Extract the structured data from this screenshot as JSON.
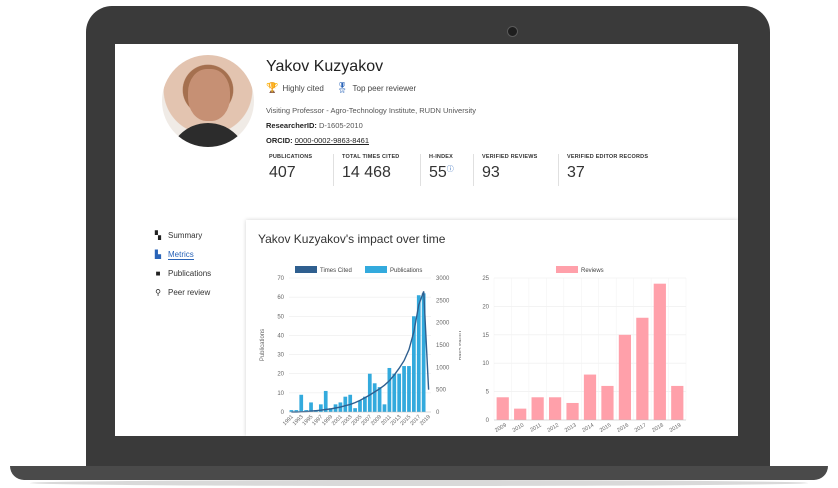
{
  "profile": {
    "name": "Yakov Kuzyakov",
    "badges": [
      {
        "label": "Highly cited",
        "icon": "trophy-icon"
      },
      {
        "label": "Top peer reviewer",
        "icon": "medal-icon"
      }
    ],
    "position": "Visiting Professor - Agro-Technology Institute, RUDN University",
    "researcher_id_label": "ResearcherID:",
    "researcher_id": "D-1605-2010",
    "orcid_label": "ORCID:",
    "orcid": "0000-0002-9863-8461"
  },
  "stats": [
    {
      "label": "PUBLICATIONS",
      "value": "407"
    },
    {
      "label": "TOTAL TIMES CITED",
      "value": "14 468"
    },
    {
      "label": "H-INDEX",
      "value": "55"
    },
    {
      "label": "VERIFIED REVIEWS",
      "value": "93"
    },
    {
      "label": "VERIFIED EDITOR RECORDS",
      "value": "37"
    }
  ],
  "nav": {
    "items": [
      {
        "label": "Summary",
        "icon": "summary-icon"
      },
      {
        "label": "Metrics",
        "icon": "metrics-icon"
      },
      {
        "label": "Publications",
        "icon": "publications-icon"
      },
      {
        "label": "Peer review",
        "icon": "search-icon"
      }
    ]
  },
  "panel": {
    "title": "Yakov Kuzyakov's impact over time"
  },
  "colors": {
    "times_cited": "#2f5f8f",
    "publications": "#33aadd",
    "reviews": "#ffa0aa"
  },
  "chart_data": [
    {
      "type": "bar",
      "legend": [
        "Times Cited",
        "Publications"
      ],
      "left_axis_label": "Publications",
      "right_axis_label": "Times cited",
      "left_ticks": [
        "0",
        "10",
        "20",
        "30",
        "40",
        "50",
        "60",
        "70"
      ],
      "right_ticks": [
        "0",
        "500",
        "1000",
        "1500",
        "2000",
        "2500",
        "3000"
      ],
      "x_tick_labels": [
        "1991",
        "1993",
        "1995",
        "1997",
        "1999",
        "2001",
        "2003",
        "2005",
        "2007",
        "2009",
        "2011",
        "2013",
        "2015",
        "2017",
        "2019"
      ],
      "x": [
        1991,
        1992,
        1993,
        1994,
        1995,
        1996,
        1997,
        1998,
        1999,
        2000,
        2001,
        2002,
        2003,
        2004,
        2005,
        2006,
        2007,
        2008,
        2009,
        2010,
        2011,
        2012,
        2013,
        2014,
        2015,
        2016,
        2017,
        2018,
        2019
      ],
      "series": [
        {
          "name": "Publications",
          "type": "bar",
          "axis": "left",
          "values": [
            1,
            1,
            9,
            1,
            5,
            1,
            4,
            11,
            2,
            4,
            5,
            8,
            9,
            2,
            6,
            8,
            20,
            15,
            13,
            4,
            23,
            20,
            20,
            24,
            24,
            50,
            61,
            62,
            0
          ]
        },
        {
          "name": "Times Cited",
          "type": "line",
          "axis": "right",
          "values": [
            0,
            0,
            5,
            10,
            20,
            30,
            40,
            55,
            70,
            90,
            110,
            140,
            170,
            210,
            260,
            320,
            380,
            450,
            520,
            600,
            700,
            830,
            980,
            1150,
            1400,
            1800,
            2400,
            2700,
            500
          ]
        }
      ],
      "ylim_left": [
        0,
        70
      ],
      "ylim_right": [
        0,
        3000
      ]
    },
    {
      "type": "bar",
      "legend": [
        "Reviews"
      ],
      "categories": [
        "2009",
        "2010",
        "2011",
        "2012",
        "2013",
        "2014",
        "2015",
        "2016",
        "2017",
        "2018",
        "2019"
      ],
      "series": [
        {
          "name": "Reviews",
          "values": [
            4,
            2,
            4,
            4,
            3,
            8,
            6,
            15,
            18,
            24,
            6
          ]
        }
      ],
      "y_ticks": [
        "0",
        "5",
        "10",
        "15",
        "20",
        "25"
      ],
      "ylim": [
        0,
        25
      ]
    }
  ]
}
